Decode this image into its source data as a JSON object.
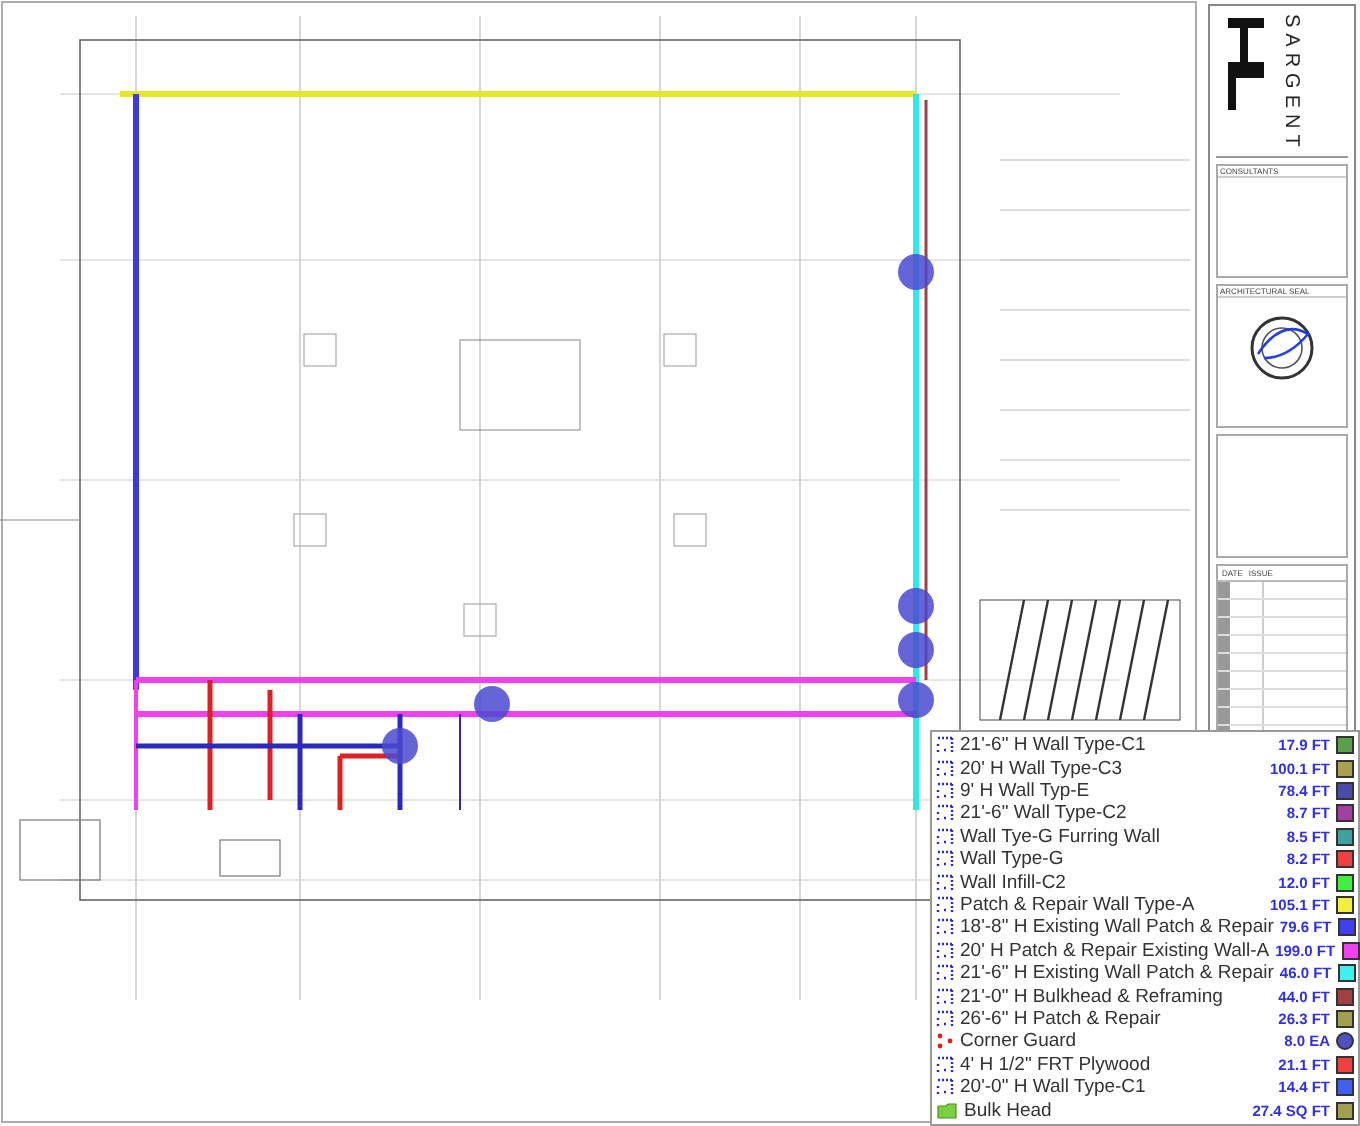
{
  "title_block": {
    "firm": "SARGENT",
    "sections": [
      "CONSULTANTS",
      "ARCHITECTURAL SEAL"
    ],
    "table_columns": [
      "DATE",
      "ISSUE"
    ]
  },
  "legend": [
    {
      "kind": "line",
      "label": "21'-6\" H Wall Type-C1",
      "quantity": "17.9 FT",
      "color": "#5aa04a"
    },
    {
      "kind": "line",
      "label": "20' H Wall Type-C3",
      "quantity": "100.1 FT",
      "color": "#a8a050"
    },
    {
      "kind": "line",
      "label": "9' H Wall Typ-E",
      "quantity": "78.4 FT",
      "color": "#4a4aa8"
    },
    {
      "kind": "line",
      "label": "21'-6\" Wall Type-C2",
      "quantity": "8.7 FT",
      "color": "#a040a0"
    },
    {
      "kind": "line",
      "label": "Wall Tye-G Furring Wall",
      "quantity": "8.5 FT",
      "color": "#40a0a0"
    },
    {
      "kind": "line",
      "label": "Wall Type-G",
      "quantity": "8.2 FT",
      "color": "#f04040"
    },
    {
      "kind": "line",
      "label": "Wall Infill-C2",
      "quantity": "12.0 FT",
      "color": "#40f040"
    },
    {
      "kind": "line",
      "label": "Patch & Repair Wall Type-A",
      "quantity": "105.1 FT",
      "color": "#f0f040"
    },
    {
      "kind": "line",
      "label": "18'-8\" H Existing Wall Patch & Repair",
      "quantity": "79.6 FT",
      "color": "#4040f0"
    },
    {
      "kind": "line",
      "label": "20' H Patch & Repair Existing Wall-A",
      "quantity": "199.0 FT",
      "color": "#f040f0"
    },
    {
      "kind": "line",
      "label": "21'-6\" H Existing Wall Patch & Repair",
      "quantity": "46.0 FT",
      "color": "#40f0f0"
    },
    {
      "kind": "line",
      "label": "21'-0\" H Bulkhead & Reframing",
      "quantity": "44.0 FT",
      "color": "#a04040"
    },
    {
      "kind": "line",
      "label": "26'-6\" H Patch & Repair",
      "quantity": "26.3 FT",
      "color": "#a0a050"
    },
    {
      "kind": "count",
      "label": "Corner Guard",
      "quantity": "8.0 EA",
      "color": "#5050c0"
    },
    {
      "kind": "line",
      "label": "4' H 1/2\" FRT Plywood",
      "quantity": "21.1 FT",
      "color": "#f04040"
    },
    {
      "kind": "line",
      "label": "20'-0\" H Wall Type-C1",
      "quantity": "14.4 FT",
      "color": "#4060f0"
    },
    {
      "kind": "area",
      "label": "Bulk Head",
      "quantity": "27.4 SQ FT",
      "color": "#a0a050"
    }
  ]
}
